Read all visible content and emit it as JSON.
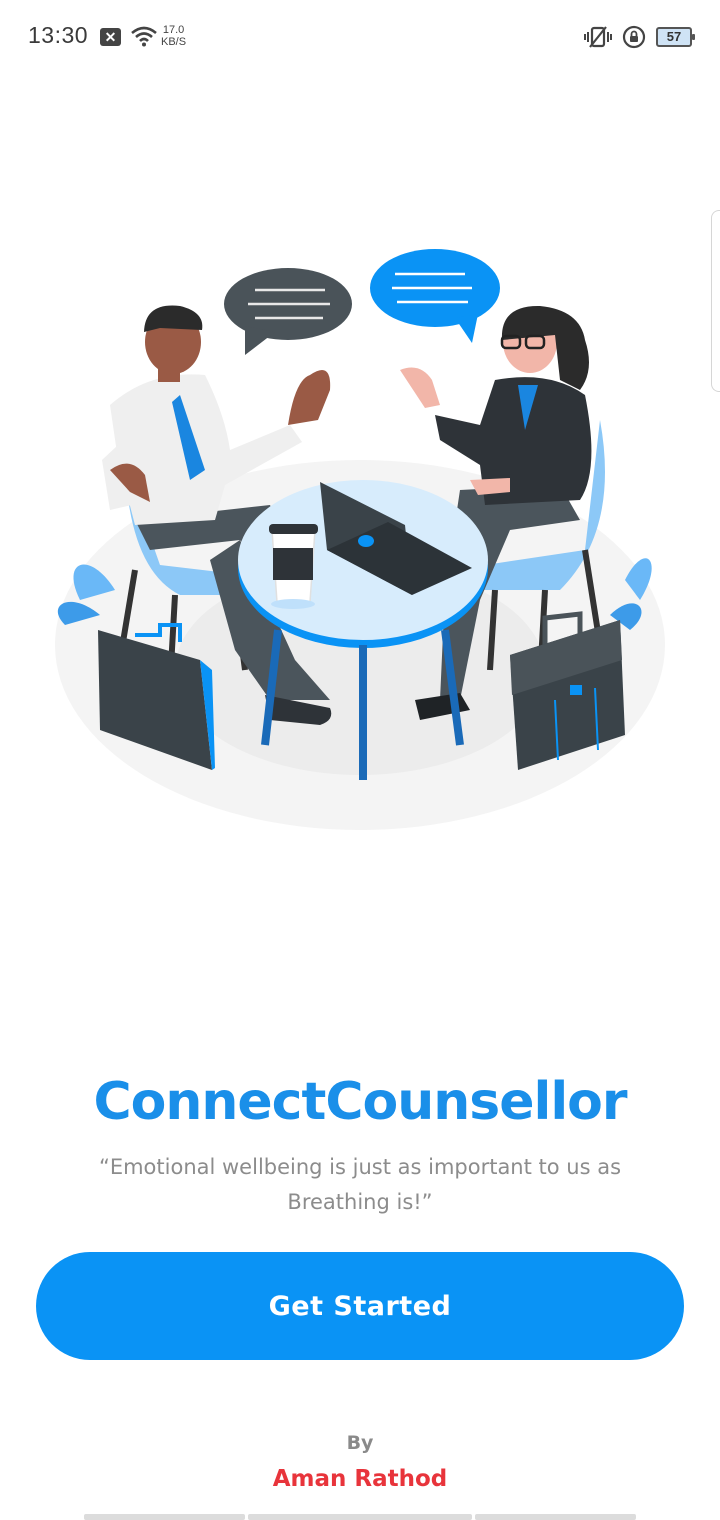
{
  "status_bar": {
    "time": "13:30",
    "net_speed_value": "17.0",
    "net_speed_unit": "KB/S",
    "battery_level": "57",
    "icons": [
      "notification-x-icon",
      "wifi-icon",
      "vibrate-mute-icon",
      "rotation-lock-icon",
      "battery-icon"
    ]
  },
  "hero": {
    "illustration": "two-people-counselling-illustration"
  },
  "app": {
    "title": "ConnectCounsellor",
    "tagline": "“Emotional wellbeing is just as important to us as Breathing is!”"
  },
  "cta": {
    "label": "Get Started"
  },
  "credits": {
    "by_label": "By",
    "author": "Aman Rathod"
  },
  "colors": {
    "primary": "#0a93f5",
    "title": "#1a8fe9",
    "author": "#e8343b",
    "tagline": "#8c8c8c"
  }
}
